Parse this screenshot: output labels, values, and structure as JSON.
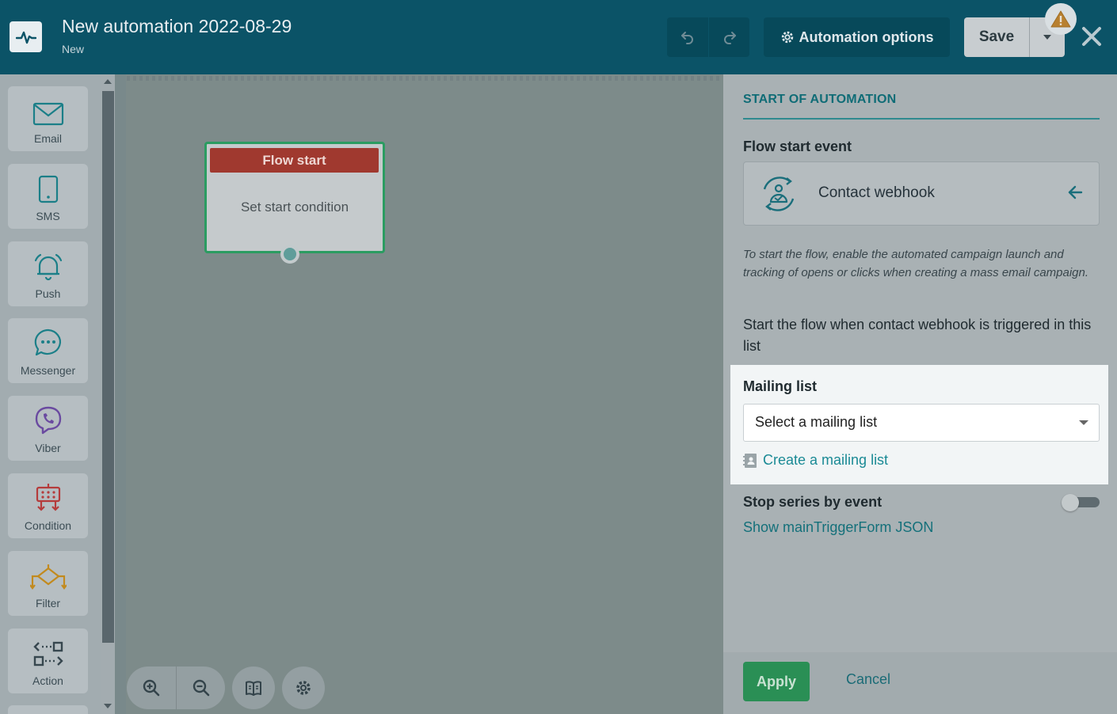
{
  "header": {
    "title": "New automation 2022-08-29",
    "status": "New",
    "automation_options_label": "Automation options",
    "save_label": "Save",
    "icons": {
      "logo": "pulse-icon",
      "undo": "undo-icon",
      "redo": "redo-icon",
      "options": "gear-icon",
      "save_menu": "chevron-down-icon",
      "warning": "warning-icon",
      "close": "close-icon"
    }
  },
  "palette": {
    "items": [
      {
        "label": "Email",
        "icon": "envelope-icon"
      },
      {
        "label": "SMS",
        "icon": "phone-icon"
      },
      {
        "label": "Push",
        "icon": "bell-icon"
      },
      {
        "label": "Messenger",
        "icon": "chat-bubble-icon"
      },
      {
        "label": "Viber",
        "icon": "viber-icon"
      },
      {
        "label": "Condition",
        "icon": "condition-icon"
      },
      {
        "label": "Filter",
        "icon": "filter-icon"
      },
      {
        "label": "Action",
        "icon": "action-icon"
      }
    ]
  },
  "canvas": {
    "node": {
      "title": "Flow start",
      "body": "Set start condition"
    },
    "controls": {
      "zoom_in": "zoom-in-icon",
      "zoom_out": "zoom-out-icon",
      "guide": "book-icon",
      "settings": "gear-icon"
    }
  },
  "panel": {
    "heading": "START OF AUTOMATION",
    "event_label": "Flow start event",
    "event_name": "Contact webhook",
    "hint": "To start the flow, enable the automated campaign launch and tracking of opens or clicks when creating a mass email campaign.",
    "description": "Start the flow when contact webhook is triggered in this list",
    "mailing_list_label": "Mailing list",
    "mailing_list_placeholder": "Select a mailing list",
    "create_list_link": "Create a mailing list",
    "stop_series_label": "Stop series by event",
    "stop_series_enabled": false,
    "json_link": "Show mainTriggerForm JSON",
    "apply_label": "Apply",
    "cancel_label": "Cancel"
  },
  "colors": {
    "header_bg": "#0b5367",
    "accent_teal": "#1a8a95",
    "node_header": "#a0392f",
    "node_border": "#2b9c61",
    "apply_green": "#2a8f55"
  }
}
